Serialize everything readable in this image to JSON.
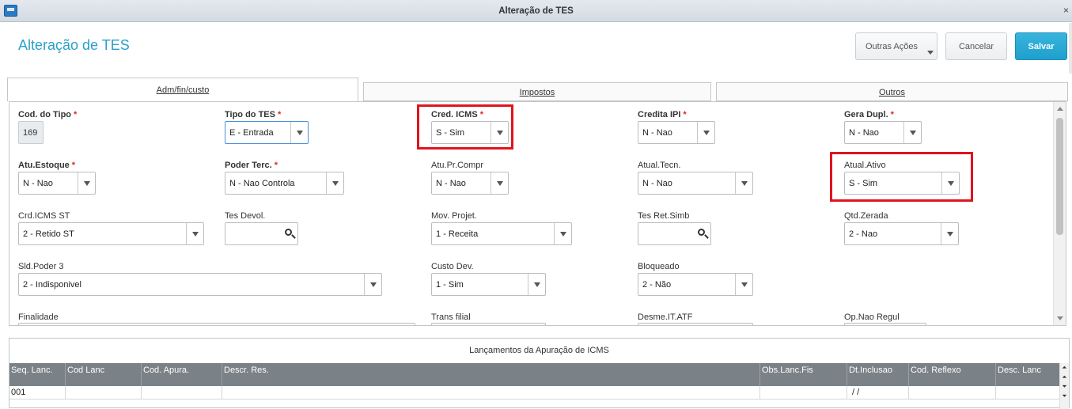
{
  "window": {
    "title": "Alteração de TES",
    "close": "×"
  },
  "header": {
    "title": "Alteração de TES",
    "buttons": {
      "outras": "Outras Ações",
      "cancelar": "Cancelar",
      "salvar": "Salvar"
    }
  },
  "tabs": [
    "Adm/fin/custo",
    "Impostos",
    "Outros"
  ],
  "fields": {
    "cod_tipo": {
      "label": "Cod. do Tipo",
      "value": "169"
    },
    "tipo_tes": {
      "label": "Tipo do TES",
      "value": "E - Entrada"
    },
    "cred_icms": {
      "label": "Cred. ICMS",
      "value": "S - Sim"
    },
    "credita_ipi": {
      "label": "Credita IPI",
      "value": "N - Nao"
    },
    "gera_dupl": {
      "label": "Gera Dupl.",
      "value": "N - Nao"
    },
    "atu_estoque": {
      "label": "Atu.Estoque",
      "value": "N - Nao"
    },
    "poder_terc": {
      "label": "Poder Terc.",
      "value": "N - Nao Controla"
    },
    "atu_pr_compr": {
      "label": "Atu.Pr.Compr",
      "value": "N - Nao"
    },
    "atual_tecn": {
      "label": "Atual.Tecn.",
      "value": "N - Nao"
    },
    "atual_ativo": {
      "label": "Atual.Ativo",
      "value": "S - Sim"
    },
    "crd_icms_st": {
      "label": "Crd.ICMS ST",
      "value": "2 - Retido ST"
    },
    "tes_devol": {
      "label": "Tes Devol.",
      "value": ""
    },
    "mov_projet": {
      "label": "Mov. Projet.",
      "value": "1 - Receita"
    },
    "tes_ret_simb": {
      "label": "Tes Ret.Simb",
      "value": ""
    },
    "qtd_zerada": {
      "label": "Qtd.Zerada",
      "value": "2 - Nao"
    },
    "sld_poder_3": {
      "label": "Sld.Poder 3",
      "value": "2 - Indisponivel"
    },
    "custo_dev": {
      "label": "Custo Dev.",
      "value": "1 - Sim"
    },
    "bloqueado": {
      "label": "Bloqueado",
      "value": "2 - Não"
    },
    "finalidade": {
      "label": "Finalidade",
      "value": ""
    },
    "trans_filial": {
      "label": "Trans filial",
      "value": ""
    },
    "desme_it_atf": {
      "label": "Desme.IT.ATF",
      "value": ""
    },
    "op_nao_regul": {
      "label": "Op.Nao Regul",
      "value": ""
    }
  },
  "grid": {
    "title": "Lançamentos da Apuração de ICMS",
    "columns": [
      "Seq. Lanc.",
      "Cod Lanc",
      "Cod. Apura.",
      "Descr. Res.",
      "Obs.Lanc.Fis",
      "Dt.Inclusao",
      "Cod. Reflexo",
      "Desc. Lanc"
    ],
    "rows": [
      [
        "001",
        "",
        "",
        "",
        "",
        " /  /",
        "",
        ""
      ]
    ]
  },
  "colors": {
    "accent": "#2aa1c6",
    "save": "#1f9fcc",
    "required": "#e0242b",
    "highlight": "#e0141e"
  }
}
